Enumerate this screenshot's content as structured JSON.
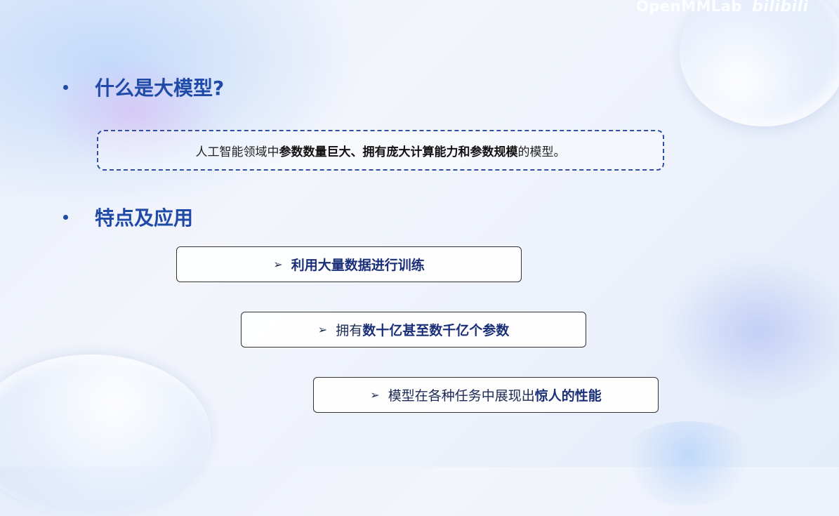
{
  "watermark": {
    "brand": "OpenMMLab",
    "platform": "bilibili"
  },
  "sections": [
    {
      "heading": "什么是大模型?"
    },
    {
      "heading": "特点及应用"
    }
  ],
  "definition": {
    "prefix": "人工智能领域中",
    "highlight1": "参数数量巨大、拥有庞大计算能力和参数规模",
    "suffix": "的模型。"
  },
  "features": [
    {
      "arrow": "➢",
      "plain": "",
      "strong": "利用大量数据进行训练"
    },
    {
      "arrow": "➢",
      "plain": "拥有",
      "strong": "数十亿甚至数千亿个参数"
    },
    {
      "arrow": "➢",
      "plain": "模型在各种任务中展现出",
      "strong": "惊人的性能"
    }
  ],
  "colors": {
    "heading": "#1f4aa8",
    "box_border": "#2f4fa0",
    "text_dark": "#1c2a55"
  },
  "icons": {
    "bullet": "bullet-dot-icon",
    "arrow": "arrowhead-icon"
  }
}
